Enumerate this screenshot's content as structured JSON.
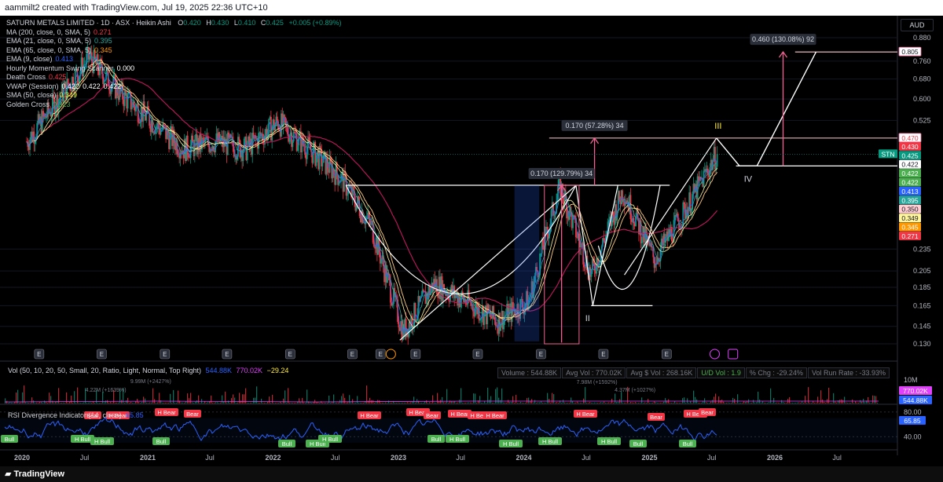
{
  "header": {
    "text": "aammilt2 created with TradingView.com, Jul 19, 2025 22:36 UTC+10"
  },
  "footer": {
    "logo_text": "TradingView"
  },
  "currency": "AUD",
  "symbol": {
    "name": "SATURN METALS LIMITED · 1D · ASX · Heikin Ashi",
    "open_label": "O",
    "open": "0.420",
    "high_label": "H",
    "high": "0.430",
    "low_label": "L",
    "low": "0.410",
    "close_label": "C",
    "close": "0.425",
    "change": "+0.005 (+0.89%)",
    "ticker": "STN"
  },
  "indicators": [
    {
      "label": "MA (200, close, 0, SMA, 5)",
      "value": "0.271",
      "color": "#f23645"
    },
    {
      "label": "EMA (21, close, 0, SMA, 5)",
      "value": "0.395",
      "color": "#26a69a"
    },
    {
      "label": "EMA (65, close, 0, SMA, 5)",
      "value": "0.345",
      "color": "#ff9800"
    },
    {
      "label": "EMA (9, close)",
      "value": "0.413",
      "color": "#2962ff"
    },
    {
      "label": "Hourly Momentum Swing Scanner",
      "value": "0.000",
      "color": "#ffffff"
    },
    {
      "label": "Death Cross",
      "value": "0.425",
      "color": "#f23645"
    },
    {
      "label": "VWAP (Session)",
      "value": "0.422",
      "value2": "0.422",
      "value3": "0.422",
      "color": "#ffffff"
    },
    {
      "label": "SMA (50, close)",
      "value": "0.349",
      "color": "#ffeb3b"
    },
    {
      "label": "Golden Cross",
      "value": "0.223",
      "color": "#4caf50"
    }
  ],
  "price_axis": {
    "ticks": [
      "0.880",
      "0.805",
      "0.760",
      "0.680",
      "0.600",
      "0.525",
      "0.470",
      "0.430",
      "0.425",
      "0.422",
      "0.422",
      "0.422",
      "0.413",
      "0.395",
      "0.350",
      "0.349",
      "0.345",
      "0.271",
      "0.235",
      "0.205",
      "0.185",
      "0.165",
      "0.145",
      "0.130"
    ],
    "major_ticks": [
      "0.880",
      "0.760",
      "0.680",
      "0.600",
      "0.525",
      "0.235",
      "0.205",
      "0.185",
      "0.165",
      "0.145",
      "0.130"
    ],
    "labels": [
      {
        "text": "0.805",
        "bg": "#ffffff",
        "fg": "#131722",
        "border": "#f06292"
      },
      {
        "text": "0.470",
        "bg": "#ffffff",
        "fg": "#f23645",
        "border": "#f06292"
      },
      {
        "text": "0.430",
        "bg": "#f23645",
        "fg": "#ffffff"
      },
      {
        "text": "0.425",
        "bg": "#089981",
        "fg": "#ffffff"
      },
      {
        "text": "0.422",
        "bg": "#ffffff",
        "fg": "#131722"
      },
      {
        "text": "0.422",
        "bg": "#4caf50",
        "fg": "#ffffff"
      },
      {
        "text": "0.422",
        "bg": "#4caf50",
        "fg": "#ffffff"
      },
      {
        "text": "0.413",
        "bg": "#2962ff",
        "fg": "#ffffff"
      },
      {
        "text": "0.395",
        "bg": "#26a69a",
        "fg": "#ffffff"
      },
      {
        "text": "0.350",
        "bg": "#ffcdd2",
        "fg": "#131722"
      },
      {
        "text": "0.349",
        "bg": "#fff59d",
        "fg": "#131722"
      },
      {
        "text": "0.345",
        "bg": "#ff9800",
        "fg": "#ffffff"
      },
      {
        "text": "0.271",
        "bg": "#f23645",
        "fg": "#ffffff"
      }
    ]
  },
  "annotations": {
    "measure_1": "0.170 (129.79%) 34",
    "measure_2": "0.170 (57.28%) 34",
    "measure_3": "0.460 (130.08%) 92",
    "wave_labels": [
      "II",
      "III",
      "IV"
    ]
  },
  "volume_panel": {
    "legend": "Vol (50, 10, 20, 50, Small, 20, Ratio, Light, Normal, Top Right)",
    "v1": "544.88K",
    "v2": "770.02K",
    "v3": "−29.24",
    "stats": [
      "Volume : 544.88K",
      "Avg Vol : 770.02K",
      "Avg $ Vol : 268.16K",
      "U/D Vol : 1.9",
      "% Chg : -29.24%",
      "Vol Run Rate : -33.93%"
    ],
    "axis_label": "10M",
    "value_labels": [
      {
        "text": "770.02K",
        "bg": "#e040fb"
      },
      {
        "text": "544.88K",
        "bg": "#2962ff"
      }
    ],
    "spike_labels": [
      "4.22M (+1639%)",
      "9.99M (+2427%)",
      "4.37M (+1027%)",
      "7.98M (+1592%)"
    ]
  },
  "rsi_panel": {
    "legend": "RSI Divergence Indicator (14, close)",
    "value": "65.85",
    "axis": [
      "80.00",
      "40.00"
    ],
    "value_label": "65.85",
    "bull_label": "Bull",
    "hbull_label": "H Bull",
    "bear_label": "Bear",
    "hbear_label": "H Bear"
  },
  "time_axis": {
    "labels": [
      "2020",
      "Jul",
      "2021",
      "Jul",
      "2022",
      "Jul",
      "2023",
      "Jul",
      "2024",
      "Jul",
      "2025",
      "Jul",
      "2026",
      "Jul"
    ],
    "bold": [
      "2020",
      "2021",
      "2022",
      "2023",
      "2024",
      "2025",
      "2026"
    ]
  },
  "chart_data": {
    "type": "candlestick",
    "title": "SATURN METALS LIMITED · 1D · ASX · Heikin Ashi",
    "x": [
      "2020-01",
      "2020-04",
      "2020-07",
      "2020-10",
      "2021-01",
      "2021-04",
      "2021-07",
      "2021-10",
      "2022-01",
      "2022-04",
      "2022-07",
      "2022-10",
      "2023-01",
      "2023-04",
      "2023-07",
      "2023-10",
      "2024-01",
      "2024-04",
      "2024-07",
      "2024-10",
      "2025-01",
      "2025-04",
      "2025-07"
    ],
    "close": [
      0.46,
      0.6,
      0.78,
      0.62,
      0.52,
      0.44,
      0.46,
      0.44,
      0.52,
      0.44,
      0.37,
      0.27,
      0.14,
      0.19,
      0.17,
      0.15,
      0.17,
      0.35,
      0.2,
      0.34,
      0.22,
      0.3,
      0.425
    ],
    "series": [
      {
        "name": "MA (200, close, 0, SMA, 5)",
        "last": 0.271
      },
      {
        "name": "EMA (21, close, 0, SMA, 5)",
        "last": 0.395
      },
      {
        "name": "EMA (65, close, 0, SMA, 5)",
        "last": 0.345
      },
      {
        "name": "EMA (9, close)",
        "last": 0.413
      },
      {
        "name": "SMA (50, close)",
        "last": 0.349
      }
    ],
    "levels": {
      "neckline_1": 0.35,
      "neckline_2": 0.47,
      "support_low": 0.165,
      "target": 0.805,
      "wave_iv": 0.395
    },
    "ylim": [
      0.125,
      0.9
    ],
    "xlabel": "",
    "ylabel": ""
  }
}
